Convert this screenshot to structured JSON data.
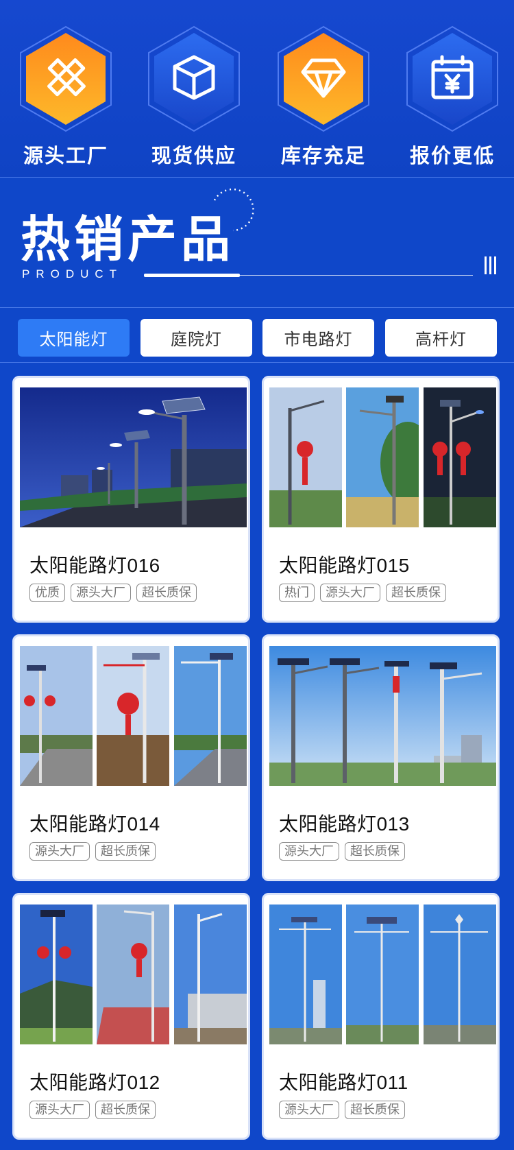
{
  "features": [
    {
      "label": "源头工厂",
      "icon": "ruler-pencil-icon",
      "style": "orange"
    },
    {
      "label": "现货供应",
      "icon": "box-icon",
      "style": "blue"
    },
    {
      "label": "库存充足",
      "icon": "diamond-icon",
      "style": "orange"
    },
    {
      "label": "报价更低",
      "icon": "calendar-yen-icon",
      "style": "blue"
    }
  ],
  "heading": {
    "title": "热销产品",
    "subtitle": "PRODUCT"
  },
  "tabs": [
    {
      "label": "太阳能灯",
      "active": true
    },
    {
      "label": "庭院灯",
      "active": false
    },
    {
      "label": "市电路灯",
      "active": false
    },
    {
      "label": "高杆灯",
      "active": false
    }
  ],
  "products": [
    {
      "name": "太阳能路灯016",
      "tags": [
        "优质",
        "源头大厂",
        "超长质保"
      ]
    },
    {
      "name": "太阳能路灯015",
      "tags": [
        "热门",
        "源头大厂",
        "超长质保"
      ]
    },
    {
      "name": "太阳能路灯014",
      "tags": [
        "源头大厂",
        "超长质保"
      ]
    },
    {
      "name": "太阳能路灯013",
      "tags": [
        "源头大厂",
        "超长质保"
      ]
    },
    {
      "name": "太阳能路灯012",
      "tags": [
        "源头大厂",
        "超长质保"
      ]
    },
    {
      "name": "太阳能路灯011",
      "tags": [
        "源头大厂",
        "超长质保"
      ]
    }
  ],
  "colors": {
    "background": "#0f47c9",
    "accent_orange": "#f7a21b",
    "accent_blue": "#2e7bf5",
    "tab_active": "#2e7bf5"
  }
}
